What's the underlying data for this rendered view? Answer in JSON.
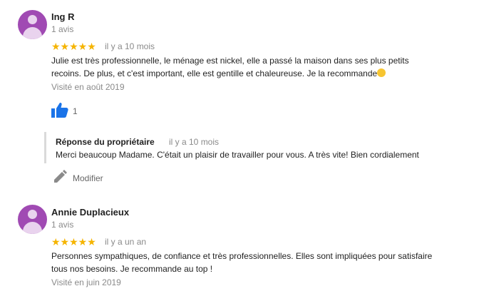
{
  "reviews": [
    {
      "name": "Ing R",
      "count": "1 avis",
      "stars": "★★★★★",
      "when": "il y a 10 mois",
      "text_line1": "Julie est très professionnelle, le ménage est nickel, elle a passé la maison dans ses plus petits",
      "text_line2": "recoins. De plus, et c'est important, elle est gentille et chaleureuse. Je la recommande",
      "visited": "Visité en août 2019",
      "likes": "1",
      "reply": {
        "title": "Réponse du propriétaire",
        "when": "il y a 10 mois",
        "text": "Merci beaucoup Madame. C'était un plaisir de travailler pour vous. A très vite! Bien cordialement"
      },
      "edit_label": "Modifier"
    },
    {
      "name": "Annie Duplacieux",
      "count": "1 avis",
      "stars": "★★★★★",
      "when": "il y a un an",
      "text_line1": "Personnes sympathiques, de confiance et très professionnelles. Elles sont impliquées pour satisfaire",
      "text_line2": "tous nos besoins.  Je recommande au top !",
      "visited": "Visité en juin 2019"
    }
  ],
  "colors": {
    "avatar": "#a04ab3",
    "star": "#f5b400",
    "like": "#1a73e8"
  },
  "icons": {
    "like": "thumbs-up-icon",
    "edit": "pencil-icon",
    "avatar": "person-icon"
  }
}
